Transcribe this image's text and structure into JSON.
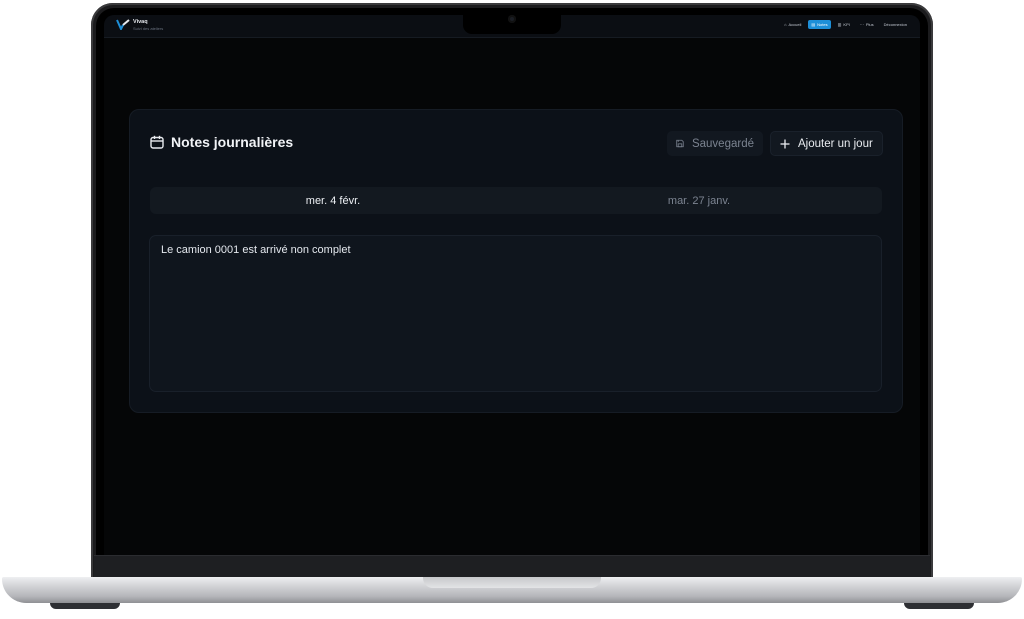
{
  "app": {
    "name": "Vivaq",
    "subtitle": "Suivi des ateliers"
  },
  "nav": {
    "items": [
      {
        "label": "Accueil",
        "icon": "home-icon",
        "active": false
      },
      {
        "label": "Notes",
        "icon": "notes-icon",
        "active": true
      },
      {
        "label": "KPI",
        "icon": "chart-icon",
        "active": false
      },
      {
        "label": "Plus",
        "icon": "more-icon",
        "active": false
      },
      {
        "label": "Déconnexion",
        "icon": "",
        "active": false
      }
    ]
  },
  "card": {
    "title": "Notes journalières",
    "saved_label": "Sauvegardé",
    "add_label": "Ajouter un jour"
  },
  "tabs": [
    {
      "label": "mer. 4 févr.",
      "active": true
    },
    {
      "label": "mar. 27 janv.",
      "active": false
    }
  ],
  "note": {
    "text": "Le camion 0001 est arrivé non complet"
  },
  "colors": {
    "accent": "#1d8fd8",
    "background": "#050607",
    "card": "#0c1118"
  }
}
